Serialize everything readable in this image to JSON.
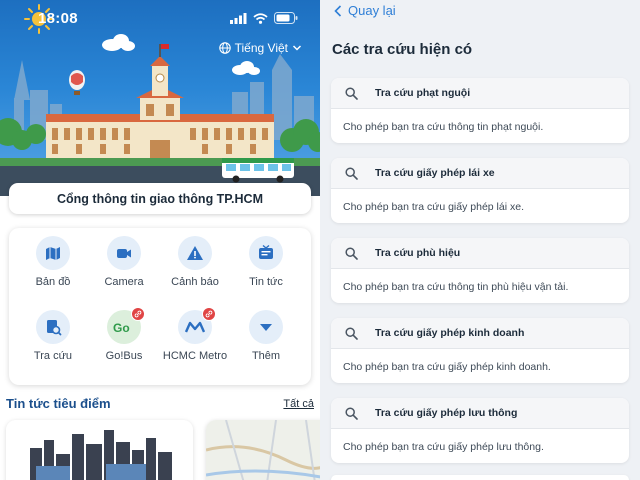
{
  "status_bar": {
    "time": "18:08"
  },
  "language": {
    "label": "Tiếng Việt"
  },
  "portal": {
    "title": "Cổng thông tin giao thông TP.HCM"
  },
  "menu": [
    {
      "label": "Bản đồ",
      "icon": "map-icon"
    },
    {
      "label": "Camera",
      "icon": "camera-icon"
    },
    {
      "label": "Cảnh báo",
      "icon": "warning-icon"
    },
    {
      "label": "Tin tức",
      "icon": "news-icon"
    },
    {
      "label": "Tra cứu",
      "icon": "lookup-icon"
    },
    {
      "label": "Go!Bus",
      "icon": "gobus-icon",
      "badge": "link-icon"
    },
    {
      "label": "HCMC Metro",
      "icon": "metro-icon",
      "badge": "link-icon"
    },
    {
      "label": "Thêm",
      "icon": "chevron-down-icon"
    }
  ],
  "news": {
    "title": "Tin tức tiêu điểm",
    "see_all": "Tất cả"
  },
  "right_page": {
    "back_label": "Quay lại",
    "title": "Các tra cứu hiện có",
    "items": [
      {
        "name": "Tra cứu phạt nguội",
        "desc": "Cho phép bạn tra cứu thông tin phạt nguội."
      },
      {
        "name": "Tra cứu giấy phép lái xe",
        "desc": "Cho phép bạn tra cứu giấy phép lái xe."
      },
      {
        "name": "Tra cứu phù hiệu",
        "desc": "Cho phép bạn tra cứu thông tin phù hiệu vận tải."
      },
      {
        "name": "Tra cứu giấy phép kinh doanh",
        "desc": "Cho phép bạn tra cứu giấy phép kinh doanh."
      },
      {
        "name": "Tra cứu giấy phép lưu thông",
        "desc": "Cho phép bạn tra cứu giấy phép lưu thông."
      }
    ]
  },
  "colors": {
    "accent": "#2f7fd6",
    "sky": "#2a86d6",
    "news_title": "#1b4f8c",
    "badge": "#e04545"
  }
}
